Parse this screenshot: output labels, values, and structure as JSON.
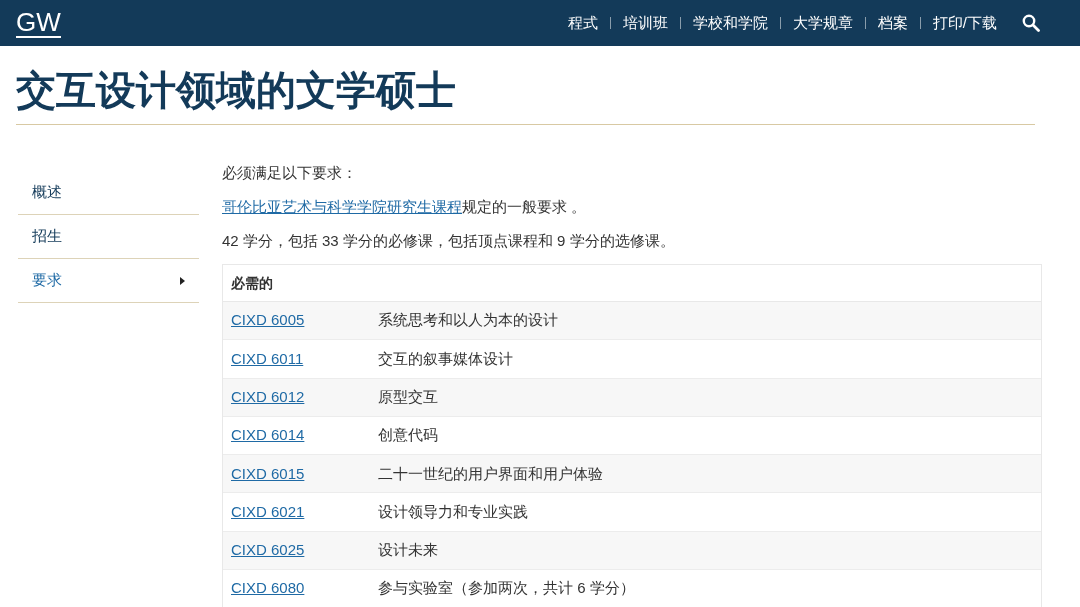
{
  "header": {
    "logo": "GW",
    "nav": [
      "程式",
      "培训班",
      "学校和学院",
      "大学规章",
      "档案",
      "打印/下载"
    ]
  },
  "title": "交互设计领域的文学硕士",
  "sidebar": {
    "items": [
      {
        "label": "概述",
        "selected": false
      },
      {
        "label": "招生",
        "selected": false
      },
      {
        "label": "要求",
        "selected": true
      }
    ]
  },
  "content": {
    "intro": "必须满足以下要求：",
    "requirement_link": "哥伦比亚艺术与科学学院研究生课程",
    "requirement_rest": "规定的一般要求 。",
    "credits": "42 学分，包括 33 学分的必修课，包括顶点课程和 9 学分的选修课。",
    "table": {
      "heading": "必需的",
      "rows": [
        {
          "code": "CIXD 6005",
          "name": "系统思考和以人为本的设计"
        },
        {
          "code": "CIXD 6011",
          "name": "交互的叙事媒体设计"
        },
        {
          "code": "CIXD 6012",
          "name": "原型交互"
        },
        {
          "code": "CIXD 6014",
          "name": "创意代码"
        },
        {
          "code": "CIXD 6015",
          "name": "二十一世纪的用户界面和用户体验"
        },
        {
          "code": "CIXD 6021",
          "name": "设计领导力和专业实践"
        },
        {
          "code": "CIXD 6025",
          "name": "设计未来"
        },
        {
          "code": "CIXD 6080",
          "name": "参与实验室（参加两次，共计 6 学分）"
        }
      ]
    }
  }
}
